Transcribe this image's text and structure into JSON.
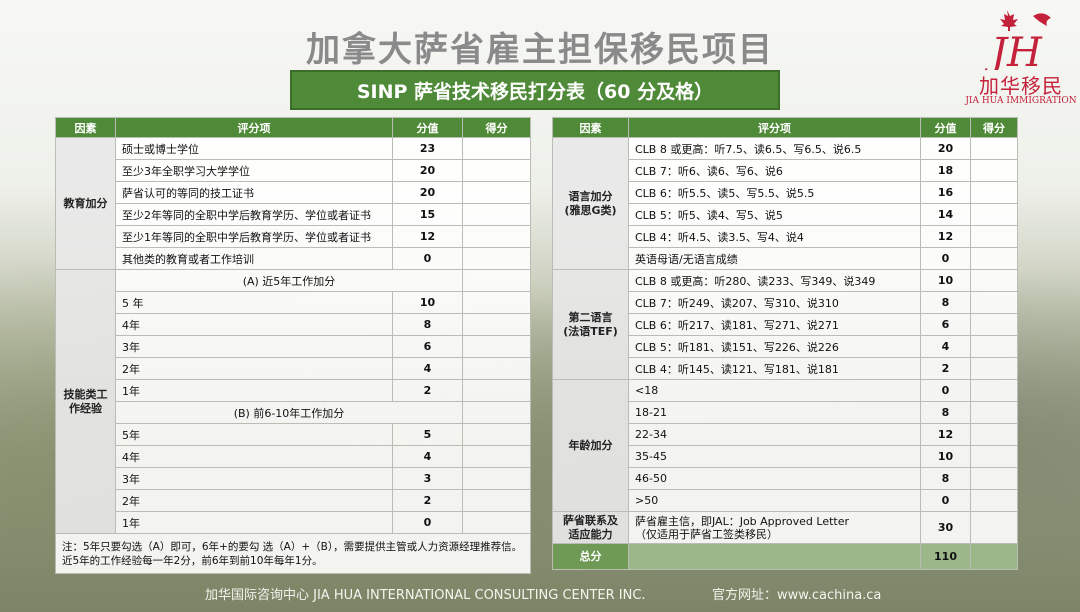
{
  "header": {
    "title": "加拿大萨省雇主担保移民项目",
    "subtitle": "SINP 萨省技术移民打分表（60 分及格）"
  },
  "logo": {
    "mark": "JH",
    "cn": "加华移民",
    "en": "JIA HUA IMMIGRATION",
    "icon": "maple-leaf-dragon-icon",
    "brand_color": "#c4213a"
  },
  "colors": {
    "header_green": "#4e8a37",
    "total_green": "#9cb88a"
  },
  "left_table": {
    "headers": [
      "因素",
      "评分项",
      "分值",
      "得分"
    ],
    "education": {
      "category": "教育加分",
      "rows": [
        {
          "item": "硕士或博士学位",
          "value": "23"
        },
        {
          "item": "至少3年全职学习大学学位",
          "value": "20"
        },
        {
          "item": "萨省认可的等同的技工证书",
          "value": "20"
        },
        {
          "item": "至少2年等同的全职中学后教育学历、学位或者证书",
          "value": "15"
        },
        {
          "item": "至少1年等同的全职中学后教育学历、学位或者证书",
          "value": "12"
        },
        {
          "item": "其他类的教育或者工作培训",
          "value": "0"
        }
      ]
    },
    "work": {
      "category": "技能类工作经验",
      "sub_a": "(A)  近5年工作加分",
      "rows_a": [
        {
          "item": "5 年",
          "value": "10"
        },
        {
          "item": "4年",
          "value": "8"
        },
        {
          "item": "3年",
          "value": "6"
        },
        {
          "item": "2年",
          "value": "4"
        },
        {
          "item": "1年",
          "value": "2"
        }
      ],
      "sub_b": "(B)  前6-10年工作加分",
      "rows_b": [
        {
          "item": "5年",
          "value": "5"
        },
        {
          "item": "4年",
          "value": "4"
        },
        {
          "item": "3年",
          "value": "3"
        },
        {
          "item": "2年",
          "value": "2"
        },
        {
          "item": "1年",
          "value": "0"
        }
      ]
    },
    "note": "注：5年只要勾选（A）即可，6年+的要勾 选（A）+（B），需要提供主管或人力资源经理推荐信。近5年的工作经验每一年2分，前6年到前10年每年1分。"
  },
  "right_table": {
    "headers": [
      "因素",
      "评分项",
      "分值",
      "得分"
    ],
    "language": {
      "category": "语言加分 (雅思G类)",
      "rows": [
        {
          "item": "CLB 8 或更高：听7.5、读6.5、写6.5、说6.5",
          "value": "20"
        },
        {
          "item": "CLB 7：听6、读6、写6、说6",
          "value": "18"
        },
        {
          "item": "CLB 6：听5.5、读5、写5.5、说5.5",
          "value": "16"
        },
        {
          "item": "CLB 5：听5、读4、写5、说5",
          "value": "14"
        },
        {
          "item": "CLB 4：听4.5、读3.5、写4、说4",
          "value": "12"
        },
        {
          "item": "英语母语/无语言成绩",
          "value": "0"
        }
      ]
    },
    "second_language": {
      "category": "第二语言 (法语TEF)",
      "rows": [
        {
          "item": "CLB 8 或更高：听280、读233、写349、说349",
          "value": "10"
        },
        {
          "item": "CLB 7：听249、读207、写310、说310",
          "value": "8"
        },
        {
          "item": "CLB 6：听217、读181、写271、说271",
          "value": "6"
        },
        {
          "item": "CLB 5：听181、读151、写226、说226",
          "value": "4"
        },
        {
          "item": "CLB 4：听145、读121、写181、说181",
          "value": "2"
        }
      ]
    },
    "age": {
      "category": "年龄加分",
      "rows": [
        {
          "item": "<18",
          "value": "0"
        },
        {
          "item": "18-21",
          "value": "8"
        },
        {
          "item": "22-34",
          "value": "12"
        },
        {
          "item": "35-45",
          "value": "10"
        },
        {
          "item": "46-50",
          "value": "8"
        },
        {
          "item": ">50",
          "value": "0"
        }
      ]
    },
    "adaptability": {
      "category": "萨省联系及适应能力",
      "item_line1": "萨省雇主信，即JAL：Job Approved Letter",
      "item_line2": "（仅适用于萨省工签类移民）",
      "value": "30"
    },
    "total": {
      "label": "总分",
      "value": "110"
    }
  },
  "footer": {
    "company": "加华国际咨询中心 JIA HUA INTERNATIONAL CONSULTING CENTER INC.",
    "website": "官方网址：www.cachina.ca"
  }
}
